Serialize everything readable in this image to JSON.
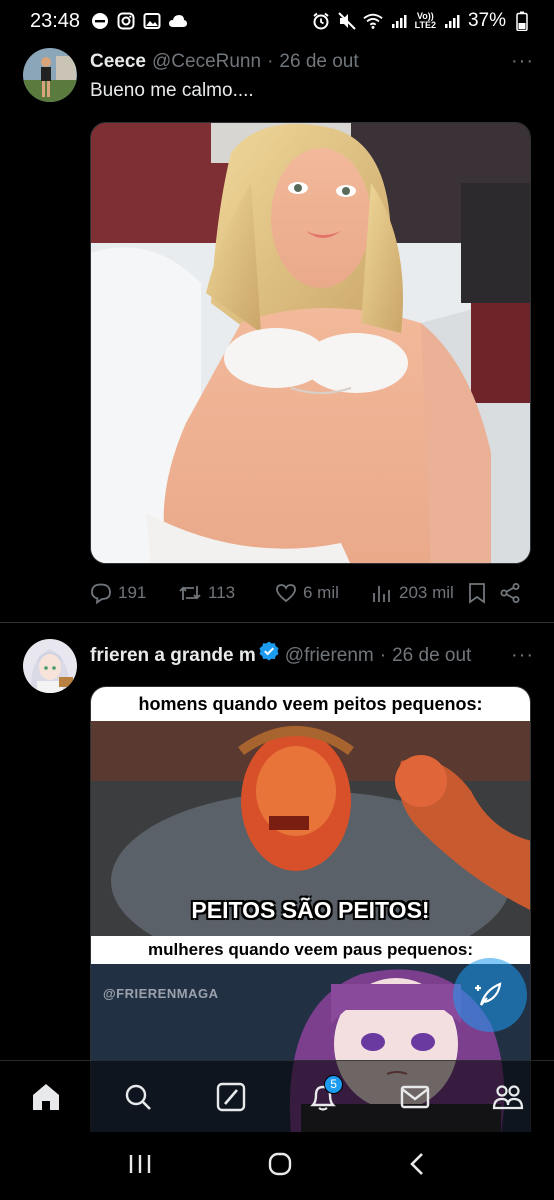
{
  "status_bar": {
    "time": "23:48",
    "battery": "37%",
    "network": "LTE2",
    "volte": "Vo))"
  },
  "tweets": [
    {
      "name": "Ceece",
      "handle": "@CeceRunn",
      "dot": "·",
      "date": "26 de out",
      "more": "···",
      "text": "Bueno me calmo....",
      "stats": {
        "replies": "191",
        "retweets": "113",
        "likes": "6 mil",
        "views": "203 mil"
      }
    },
    {
      "name": "frieren a grande m",
      "handle": "@frierenm",
      "dot": "·",
      "date": "26 de out",
      "more": "···",
      "meme": {
        "caption_top": "homens quando veem peitos pequenos:",
        "overlay": "PEITOS SÃO PEITOS!",
        "caption_bottom": "mulheres quando veem paus pequenos:",
        "watermark": "@FRIERENMAGA"
      }
    }
  ],
  "bottom_nav": {
    "items": [
      "home-icon",
      "search-icon",
      "grok-icon",
      "notifications-icon",
      "messages-icon",
      "communities-icon"
    ],
    "notifications_badge": "5"
  },
  "colors": {
    "accent": "#1d9bf0",
    "muted": "#71767b",
    "text": "#e7e9ea"
  }
}
